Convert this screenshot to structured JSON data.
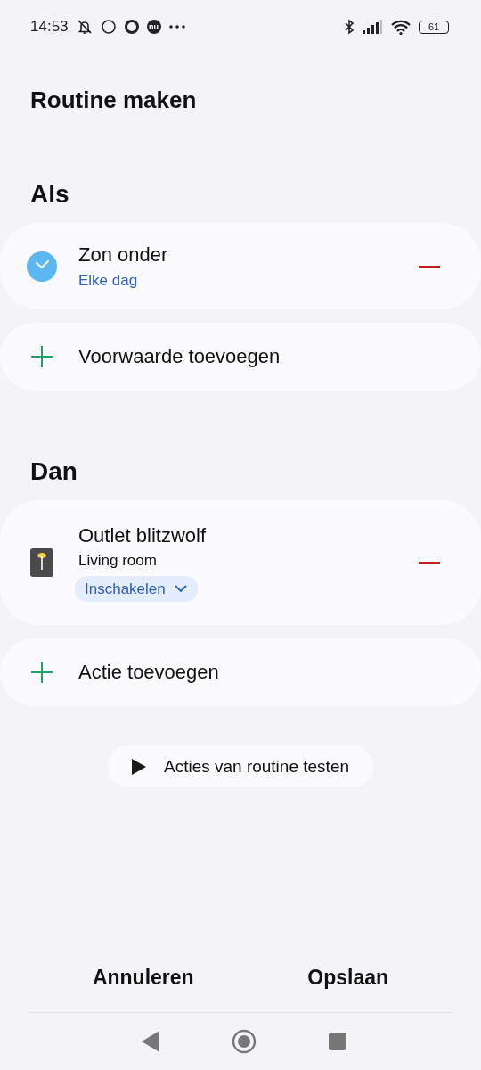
{
  "status_bar": {
    "time": "14:53",
    "app_badge": "nu",
    "battery": "61"
  },
  "title": "Routine maken",
  "sections": [
    {
      "heading": "Als",
      "items": [
        {
          "kind": "condition",
          "title": "Zon onder",
          "subtitle": "Elke dag"
        },
        {
          "kind": "add",
          "label": "Voorwaarde toevoegen"
        }
      ]
    },
    {
      "heading": "Dan",
      "items": [
        {
          "kind": "device",
          "title": "Outlet blitzwolf",
          "room": "Living room",
          "action": "Inschakelen"
        },
        {
          "kind": "add",
          "label": "Actie toevoegen"
        }
      ]
    }
  ],
  "test_button": "Acties van routine testen",
  "buttons": [
    "Annuleren",
    "Opslaan"
  ]
}
